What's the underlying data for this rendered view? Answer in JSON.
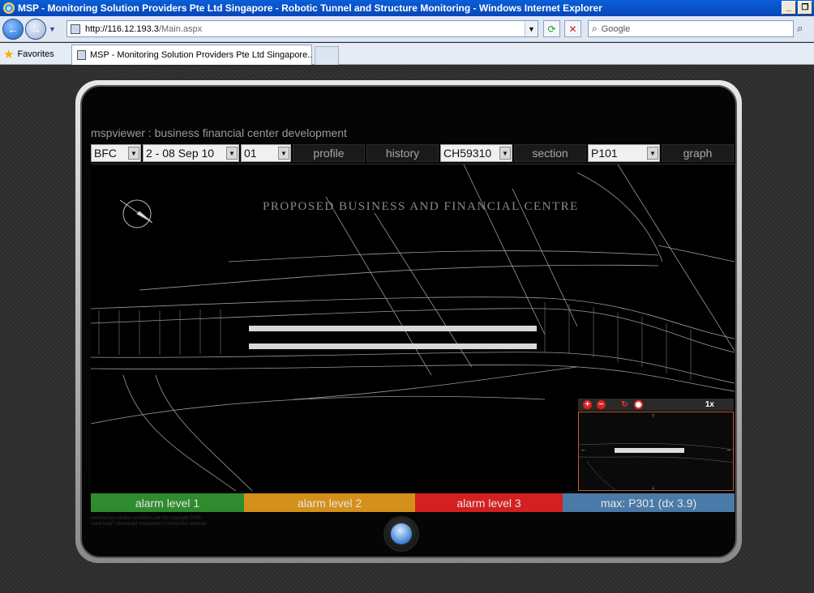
{
  "window": {
    "title": "MSP - Monitoring Solution Providers Pte Ltd Singapore - Robotic Tunnel and Structure Monitoring - Windows Internet Explorer"
  },
  "browser": {
    "url_host": "http://116.12.193.3",
    "url_path": "/Main.aspx",
    "search_placeholder": "Google",
    "favorites_label": "Favorites",
    "tab_title": "MSP - Monitoring Solution Providers Pte Ltd Singapore..."
  },
  "app": {
    "title": "mspviewer : business financial center development",
    "site_select": "BFC",
    "date_select": "2 - 08 Sep 10",
    "num_select": "01",
    "profile_label": "profile",
    "history_label": "history",
    "chainage_select": "CH59310",
    "section_label": "section",
    "point_select": "P101",
    "graph_label": "graph",
    "drawing_title": "PROPOSED  BUSINESS  AND  FINANCIAL  CENTRE",
    "minimap_zoom": "1x",
    "alarms": [
      {
        "label": "alarm level 1",
        "color": "#2e8b2e"
      },
      {
        "label": "alarm level 2",
        "color": "#d4901a"
      },
      {
        "label": "alarm level 3",
        "color": "#d42020"
      },
      {
        "label": "max: P301 (dx 3.9)",
        "color": "#4a7aa8"
      }
    ],
    "copyright": "monitoring solution providers pte ltd copyright 2009",
    "manual": "need help? download mspviewer's instruction manual"
  }
}
